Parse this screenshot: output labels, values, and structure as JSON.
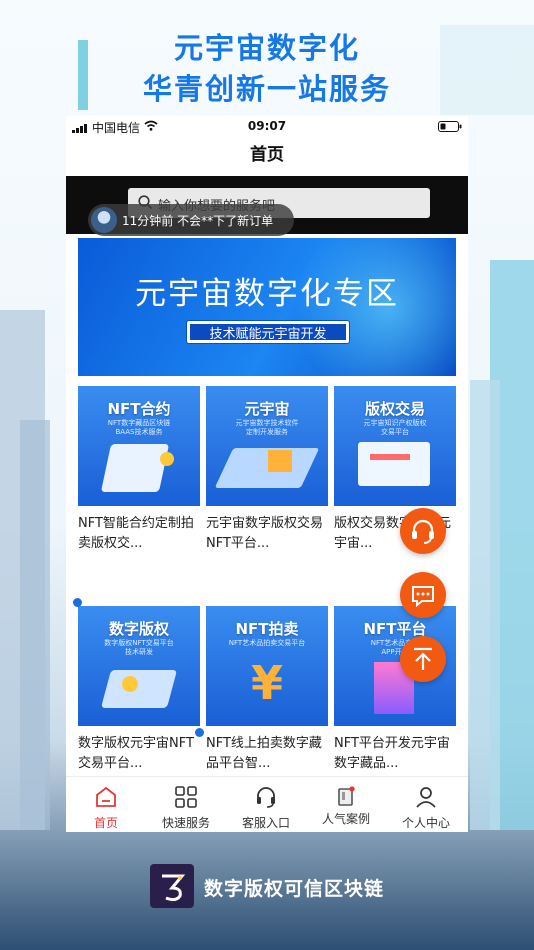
{
  "promo": {
    "line1": "元宇宙数字化",
    "line2": "华青创新一站服务"
  },
  "status_bar": {
    "carrier": "中国电信",
    "time": "09:07"
  },
  "nav": {
    "title": "首页"
  },
  "search": {
    "placeholder": "输入你想要的服务吧"
  },
  "toast": {
    "text": "11分钟前  不会**下了新订单"
  },
  "banner": {
    "title": "元宇宙数字化专区",
    "subtitle": "技术赋能元宇宙开发"
  },
  "cards": [
    {
      "image_title": "NFT合约",
      "image_sub": "NFT数字藏品区块链\nBAAS技术服务",
      "text": "NFT智能合约定制拍卖版权交..."
    },
    {
      "image_title": "元宇宙",
      "image_sub": "元宇宙数字技术软件\n定制开发服务",
      "text": "元宇宙数字版权交易NFT平台..."
    },
    {
      "image_title": "版权交易",
      "image_sub": "元宇宙知识产权版权\n交易平台",
      "text": "版权交易数字藏品元宇宙..."
    },
    {
      "image_title": "数字版权",
      "image_sub": "数字版权NFT交易平台\n技术研发",
      "text": "数字版权元宇宙NFT交易平台..."
    },
    {
      "image_title": "NFT拍卖",
      "image_sub": "NFT艺术品拍卖交易平台",
      "text": "NFT线上拍卖数字藏品平台智..."
    },
    {
      "image_title": "NFT平台",
      "image_sub": "NFT艺术品交易\nAPP开发",
      "text": "NFT平台开发元宇宙数字藏品..."
    }
  ],
  "tabs": [
    {
      "label": "首页",
      "icon": "home-icon",
      "active": true
    },
    {
      "label": "快速服务",
      "icon": "grid-icon",
      "active": false
    },
    {
      "label": "客服入口",
      "icon": "headset-icon",
      "active": false
    },
    {
      "label": "人气案例",
      "icon": "book-icon",
      "active": false
    },
    {
      "label": "个人中心",
      "icon": "person-icon",
      "active": false
    }
  ],
  "footer": {
    "brand_text": "数字版权可信区块链"
  },
  "colors": {
    "accent": "#f25a12",
    "brand_blue": "#1677e6",
    "tab_active": "#e53935"
  }
}
